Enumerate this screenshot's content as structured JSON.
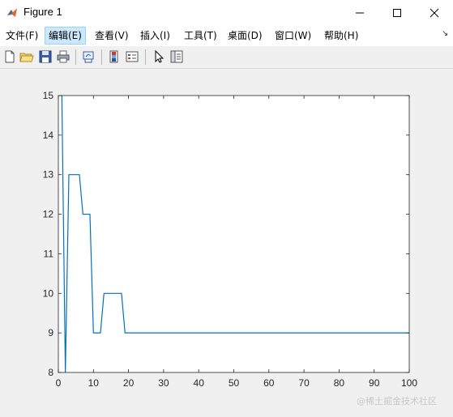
{
  "window": {
    "title": "Figure 1",
    "app_icon": "matlab-icon"
  },
  "menu": {
    "items": [
      {
        "label": "文件(F)"
      },
      {
        "label": "编辑(E)",
        "active": true
      },
      {
        "label": "查看(V)"
      },
      {
        "label": "插入(I)"
      },
      {
        "label": "工具(T)"
      },
      {
        "label": "桌面(D)"
      },
      {
        "label": "窗口(W)"
      },
      {
        "label": "帮助(H)"
      }
    ]
  },
  "toolbar": {
    "buttons": [
      "new-figure-icon",
      "open-file-icon",
      "save-icon",
      "print-icon",
      "link-plot-icon",
      "colorbar-icon",
      "legend-icon",
      "edit-plot-icon",
      "property-editor-icon"
    ]
  },
  "chart_data": {
    "type": "line",
    "title": "",
    "xlabel": "",
    "ylabel": "",
    "xlim": [
      0,
      100
    ],
    "ylim": [
      8,
      15
    ],
    "xticks": [
      0,
      10,
      20,
      30,
      40,
      50,
      60,
      70,
      80,
      90,
      100
    ],
    "yticks": [
      8,
      9,
      10,
      11,
      12,
      13,
      14,
      15
    ],
    "grid": false,
    "series": [
      {
        "color": "#0072bd",
        "x": [
          1,
          2,
          3,
          4,
          5,
          6,
          7,
          8,
          9,
          10,
          11,
          12,
          13,
          14,
          15,
          16,
          17,
          18,
          19,
          20,
          100
        ],
        "y": [
          15,
          8,
          13,
          13,
          13,
          13,
          12,
          12,
          12,
          9,
          9,
          9,
          10,
          10,
          10,
          10,
          10,
          10,
          9,
          9,
          9
        ]
      }
    ]
  },
  "watermark": "@稀土掘金技术社区"
}
